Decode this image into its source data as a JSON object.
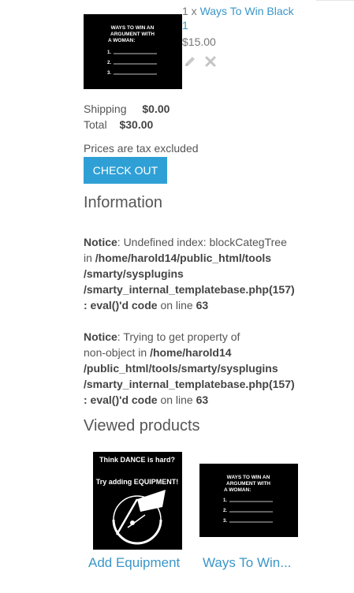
{
  "cart": {
    "quantity_prefix": "1 x ",
    "product_name_line1": "Ways To Win Black",
    "product_name_line2": "1",
    "price": "$15.00",
    "thumb_text": {
      "line1": "WAYS TO WIN AN",
      "line2": "ARGUMENT WITH",
      "line3": "A WOMAN:",
      "n1": "1.",
      "n2": "2.",
      "n3": "3."
    },
    "shipping_label": "Shipping",
    "shipping_value": "$0.00",
    "total_label": "Total",
    "total_value": "$30.00",
    "tax_note": "Prices are tax excluded",
    "checkout_label": "CHECK OUT"
  },
  "information": {
    "heading": "Information",
    "notice1": {
      "label": "Notice",
      "sep": ": Undefined index: blockCategTree",
      "in": "in ",
      "path1": "/home/harold14/public_html/tools",
      "path2": "/smarty/sysplugins",
      "path3": "/smarty_internal_templatebase.php(157)",
      "eval": ": eval()'d code",
      "on_line": " on line ",
      "line": "63"
    },
    "notice2": {
      "label": "Notice",
      "sep": ": Trying to get property of",
      "in": "non-object in ",
      "path1": "/home/harold14",
      "path2": "/public_html/tools/smarty/sysplugins",
      "path3": "/smarty_internal_templatebase.php(157)",
      "eval": ": eval()'d code",
      "on_line": " on line ",
      "line": "63"
    }
  },
  "viewed": {
    "heading": "Viewed products",
    "items": [
      {
        "name": "Add Equipment",
        "img_text1": "Think DANCE is hard?",
        "img_text2": "Try adding EQUIPMENT!"
      },
      {
        "name": "Ways To Win...",
        "img_text1": "WAYS TO WIN AN",
        "img_text2": "ARGUMENT WITH",
        "img_text3": "A WOMAN:",
        "n1": "1.",
        "n2": "2.",
        "n3": "3."
      }
    ]
  }
}
